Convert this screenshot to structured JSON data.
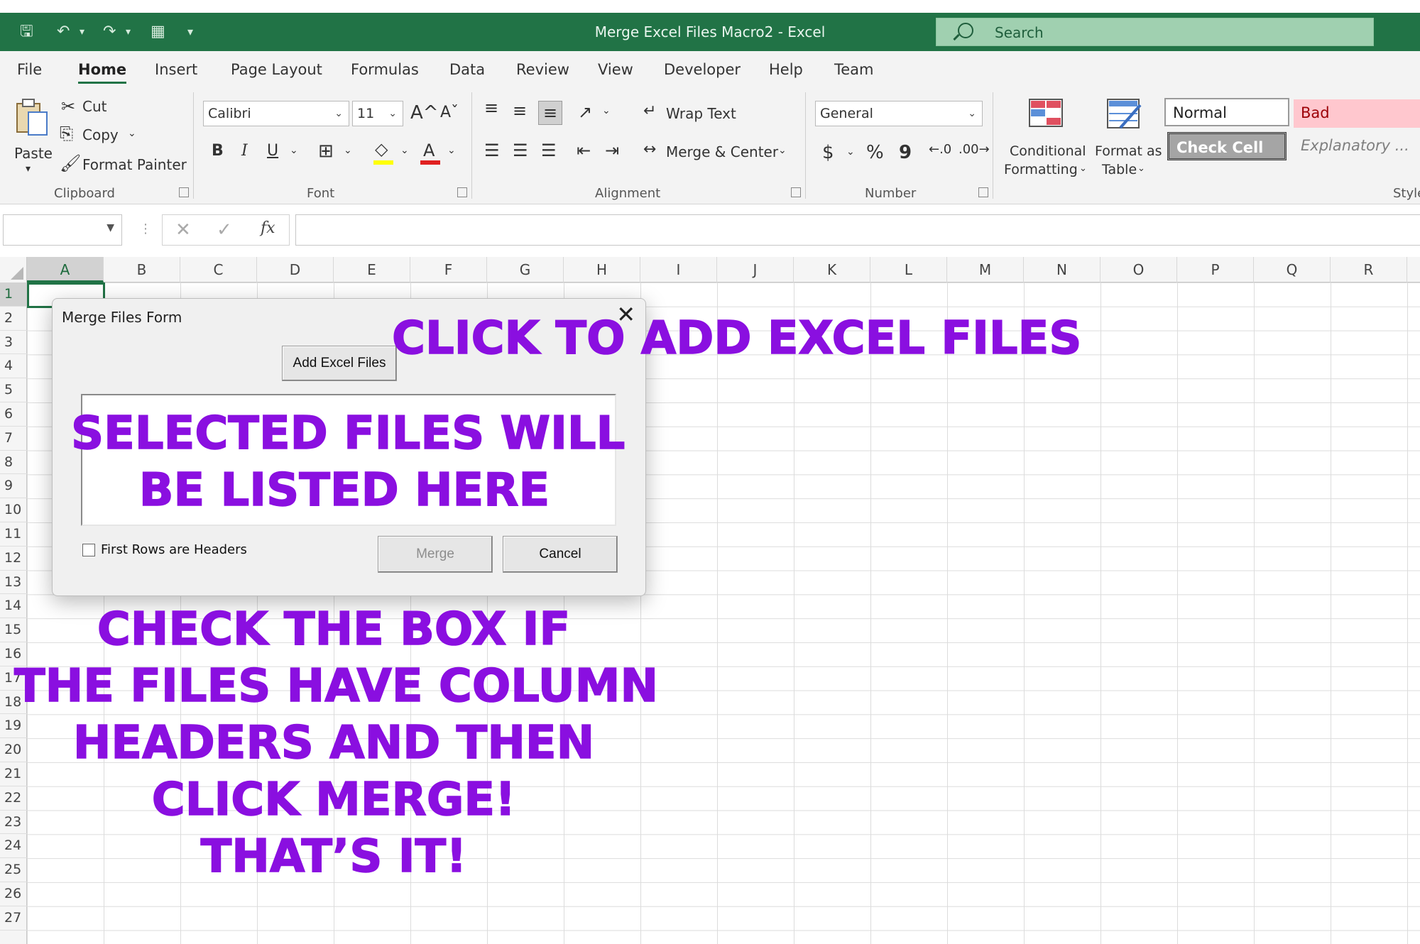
{
  "titlebar": {
    "title": "Merge Excel Files Macro2  -  Excel",
    "search_label": "Search"
  },
  "menu": [
    "File",
    "Home",
    "Insert",
    "Page Layout",
    "Formulas",
    "Data",
    "Review",
    "View",
    "Developer",
    "Help",
    "Team"
  ],
  "ribbon": {
    "clipboard": {
      "paste": "Paste",
      "cut": "Cut",
      "copy": "Copy",
      "format_painter": "Format Painter",
      "label": "Clipboard"
    },
    "font": {
      "name": "Calibri",
      "size": "11",
      "bold": "B",
      "italic": "I",
      "underline": "U",
      "grow": "A^",
      "shrink": "Aˇ",
      "label": "Font"
    },
    "alignment": {
      "wrap_text": "Wrap Text",
      "merge_center": "Merge & Center",
      "label": "Alignment"
    },
    "number": {
      "format": "General",
      "currency": "$",
      "percent": "%",
      "comma": "9",
      "label": "Number"
    },
    "styles": {
      "conditional_line1": "Conditional",
      "conditional_line2": "Formatting",
      "table_line1": "Format as",
      "table_line2": "Table",
      "normal": "Normal",
      "bad": "Bad",
      "check_cell": "Check Cell",
      "explanatory": "Explanatory ...",
      "label": "Style"
    }
  },
  "formula_bar": {
    "fx": "fx"
  },
  "grid": {
    "columns": [
      "A",
      "B",
      "C",
      "D",
      "E",
      "F",
      "G",
      "H",
      "I",
      "J",
      "K",
      "L",
      "M",
      "N",
      "O",
      "P",
      "Q",
      "R"
    ],
    "rows": [
      "1",
      "2",
      "3",
      "4",
      "5",
      "6",
      "7",
      "8",
      "9",
      "10",
      "11",
      "12",
      "13",
      "14",
      "15",
      "16",
      "17",
      "18",
      "19",
      "20",
      "21",
      "22",
      "23",
      "24",
      "25",
      "26",
      "27"
    ],
    "selected_column": "A",
    "selected_row": "1"
  },
  "dialog": {
    "title": "Merge Files Form",
    "add_button": "Add Excel Files",
    "checkbox_label": "First Rows are Headers",
    "checkbox_checked": false,
    "merge_button": "Merge",
    "cancel_button": "Cancel"
  },
  "annotations": {
    "add_files": "CLICK TO ADD EXCEL FILES",
    "listed_line1": "SELECTED FILES WILL",
    "listed_line2": "BE LISTED HERE",
    "check_line1": "CHECK THE BOX IF",
    "check_line2": "THE FILES HAVE COLUMN",
    "check_line3": "HEADERS AND THEN",
    "check_line4": "CLICK MERGE!",
    "check_line5": "THAT’S IT!"
  },
  "colors": {
    "excel_green": "#217346",
    "annotation_purple": "#8a0fe0",
    "bad_fill": "#ffc7ce",
    "bad_text": "#9c0006"
  }
}
